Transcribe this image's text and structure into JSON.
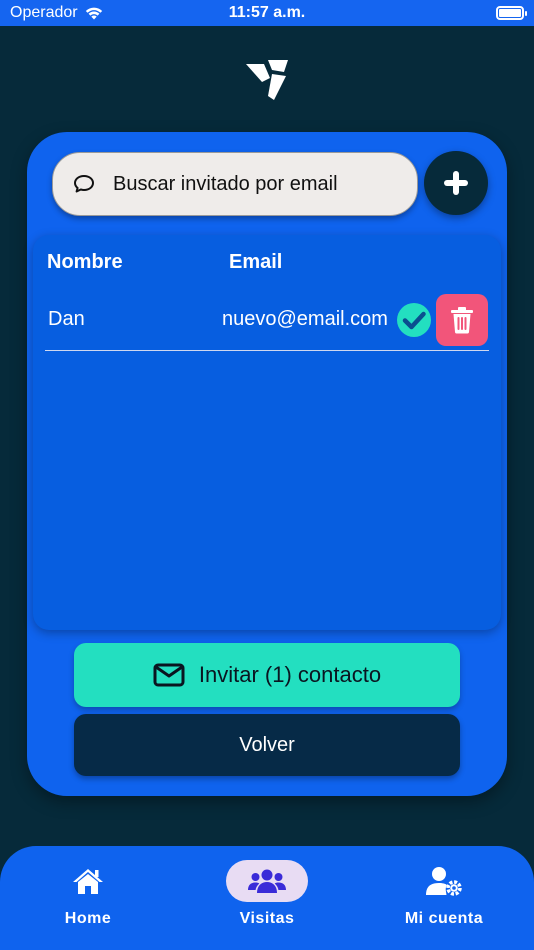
{
  "status_bar": {
    "carrier": "Operador",
    "time": "11:57 a.m."
  },
  "search": {
    "placeholder": "Buscar invitado por email"
  },
  "table": {
    "headers": {
      "name": "Nombre",
      "email": "Email"
    },
    "rows": [
      {
        "name": "Dan",
        "email": "nuevo@email.com",
        "verified": true
      }
    ]
  },
  "actions": {
    "invite_label": "Invitar (1) contacto",
    "back_label": "Volver"
  },
  "nav": {
    "items": [
      {
        "label": "Home",
        "icon": "home-icon",
        "active": false
      },
      {
        "label": "Visitas",
        "icon": "users-icon",
        "active": true
      },
      {
        "label": "Mi cuenta",
        "icon": "user-gear-icon",
        "active": false
      }
    ]
  },
  "colors": {
    "background": "#062a3a",
    "card": "#0f63ee",
    "accent": "#23dfc0",
    "danger": "#f2557a",
    "active_nav": "#e8dcf3"
  }
}
